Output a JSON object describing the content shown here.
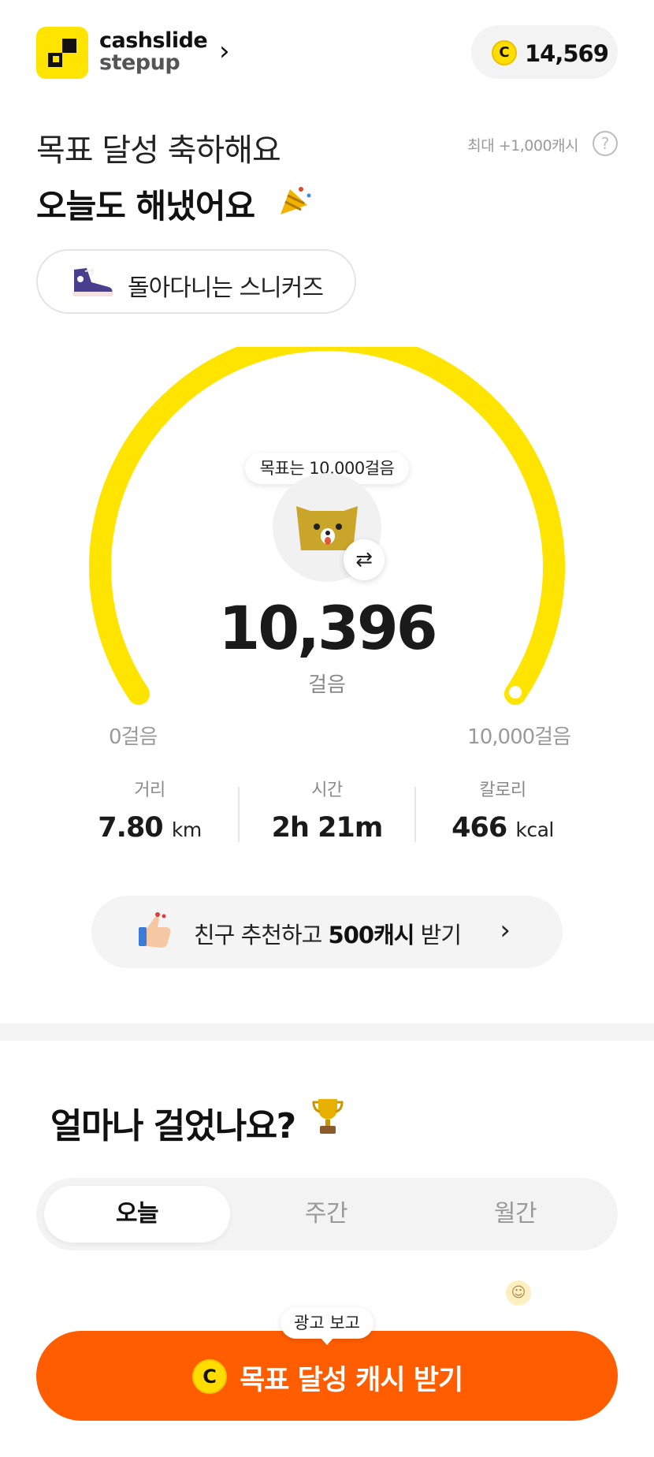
{
  "header": {
    "brand_line1": "cashslide",
    "brand_line2": "stepup",
    "cash_balance": "14,569",
    "coin_symbol": "C"
  },
  "hero": {
    "title_line1": "목표 달성 축하해요",
    "title_line2": "오늘도 해냈어요",
    "max_reward_note": "최대 +1,000캐시",
    "help_symbol": "?"
  },
  "badge": {
    "label": "돌아다니는 스니커즈"
  },
  "gauge": {
    "goal_tooltip": "목표는 10,000걸음",
    "steps_value": "10,396",
    "steps_unit": "걸음",
    "min_label": "0걸음",
    "max_label": "10,000걸음",
    "progress": 1.0,
    "color": "#ffe400",
    "swap_symbol": "⇄"
  },
  "stats": {
    "distance": {
      "label": "거리",
      "value": "7.80",
      "unit": "km"
    },
    "time": {
      "label": "시간",
      "value": "2h 21m"
    },
    "calories": {
      "label": "칼로리",
      "value": "466",
      "unit": "kcal"
    }
  },
  "refer": {
    "text_before": "친구 추천하고 ",
    "text_bold": "500캐시",
    "text_after": " 받기"
  },
  "history": {
    "heading": "얼마나 걸었나요?",
    "tabs": [
      "오늘",
      "주간",
      "월간"
    ],
    "active_tab": "오늘"
  },
  "cta": {
    "ad_tooltip": "광고 보고",
    "label": "목표 달성 캐시 받기",
    "color": "#ff5d00"
  }
}
